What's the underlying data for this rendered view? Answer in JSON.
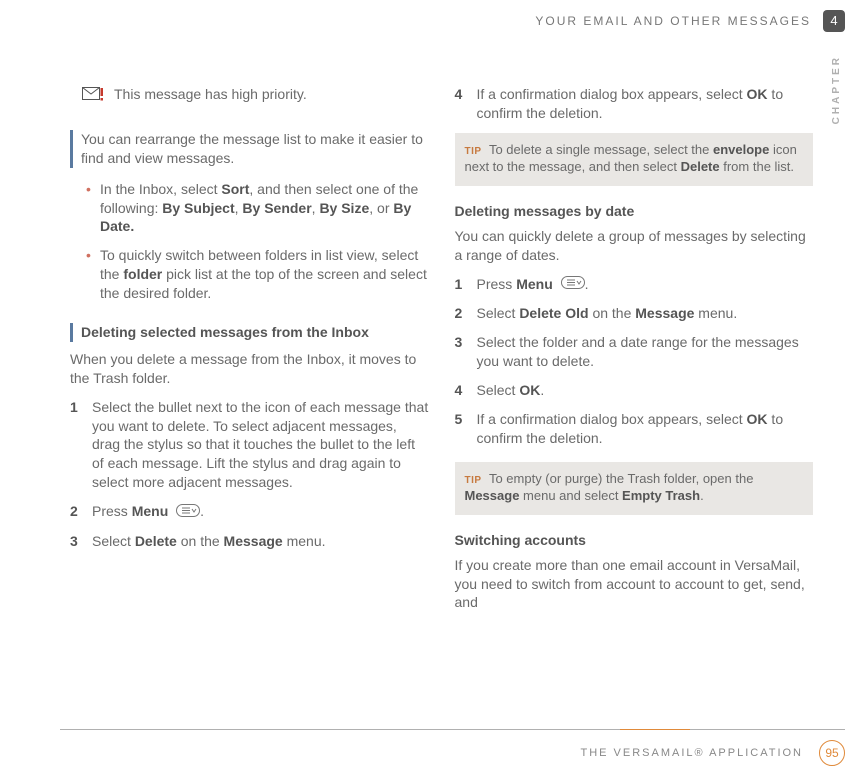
{
  "header": {
    "title": "YOUR EMAIL AND OTHER MESSAGES",
    "chapter_number": "4",
    "side_label": "CHAPTER"
  },
  "left": {
    "priority_text": "This message has high priority.",
    "intro": "You can rearrange the message list to make it easier to find and view messages.",
    "bullets": {
      "b1_pre": "In the Inbox, select ",
      "b1_sort": "Sort",
      "b1_mid": ", and then select one of the following: ",
      "b1_opt1": "By Subject",
      "b1_sep1": ", ",
      "b1_opt2": "By Sender",
      "b1_sep2": ", ",
      "b1_opt3": "By Size",
      "b1_sep3": ", or ",
      "b1_opt4": "By Date.",
      "b2_pre": "To quickly switch between folders in list view, select the ",
      "b2_bold": "folder",
      "b2_post": " pick list at the top of the screen and select the desired folder."
    },
    "del_heading": "Deleting selected messages from the Inbox",
    "del_intro": "When you delete a message from the Inbox, it moves to the Trash folder.",
    "steps": {
      "s1": "Select the bullet next to the icon of each message that you want to delete. To select adjacent messages, drag the stylus so that it touches the bullet to the left of each message. Lift the stylus and drag again to select more adjacent messages.",
      "s2_pre": "Press ",
      "s2_bold": "Menu",
      "s2_post": ".",
      "s3_pre": "Select ",
      "s3_b1": "Delete",
      "s3_mid": " on the ",
      "s3_b2": "Message",
      "s3_post": " menu."
    },
    "nums": {
      "n1": "1",
      "n2": "2",
      "n3": "3"
    }
  },
  "right": {
    "top_step": {
      "num": "4",
      "pre": "If a confirmation dialog box appears, select ",
      "bold": "OK",
      "post": " to confirm the deletion."
    },
    "tip1": {
      "label": "TIP",
      "pre": "To delete a single message, select the ",
      "b1": "envelope",
      "mid": " icon next to the message, and then select ",
      "b2": "Delete",
      "post": " from the list."
    },
    "date_heading": "Deleting messages by date",
    "date_intro": "You can quickly delete a group of messages by selecting a range of dates.",
    "dsteps": {
      "n1": "1",
      "s1_pre": "Press ",
      "s1_bold": "Menu",
      "s1_post": ".",
      "n2": "2",
      "s2_pre": "Select ",
      "s2_b1": "Delete Old",
      "s2_mid": " on the ",
      "s2_b2": "Message",
      "s2_post": " menu.",
      "n3": "3",
      "s3": "Select the folder and a date range for the messages you want to delete.",
      "n4": "4",
      "s4_pre": "Select ",
      "s4_bold": "OK",
      "s4_post": ".",
      "n5": "5",
      "s5_pre": "If a confirmation dialog box appears, select ",
      "s5_bold": "OK",
      "s5_post": " to confirm the deletion."
    },
    "tip2": {
      "label": "TIP",
      "pre": "To empty (or purge) the Trash folder, open the ",
      "b1": "Message",
      "mid": " menu and select ",
      "b2": "Empty Trash",
      "post": "."
    },
    "switch_heading": "Switching accounts",
    "switch_body": "If you create more than one email account in VersaMail, you need to switch from account to account to get, send, and"
  },
  "footer": {
    "title": "THE VERSAMAIL® APPLICATION",
    "page": "95"
  }
}
